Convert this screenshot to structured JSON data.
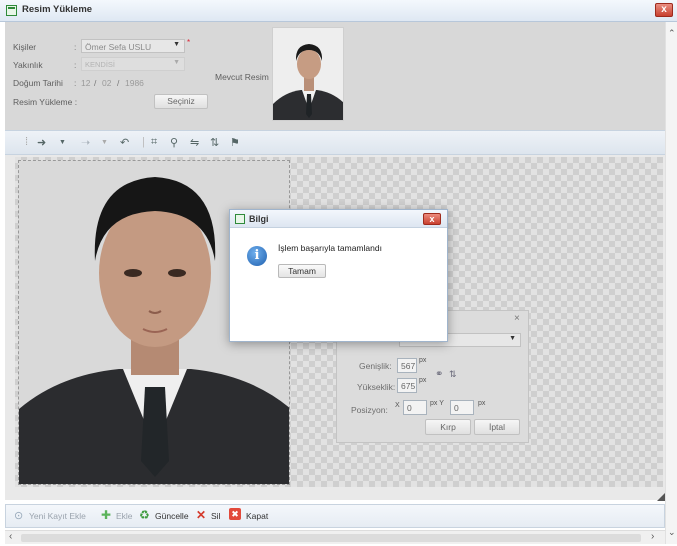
{
  "window": {
    "title": "Resim Yükleme",
    "close_glyph": "x"
  },
  "form": {
    "kisiler_label": "Kişiler",
    "kisiler_value": "Ömer Sefa USLU",
    "yakinlik_label": "Yakınlık",
    "yakinlik_value": "KENDİSİ",
    "dogum_label": "Doğum Tarihi",
    "dogum_day": "12",
    "dogum_month": "02",
    "dogum_year": "1986",
    "resim_label": "Resim Yükleme :",
    "secin_button": "Seçiniz",
    "mevcut_label": "Mevcut Resim :",
    "sep": ":",
    "date_sep": "/",
    "required_mark": "*"
  },
  "toolbar": {
    "icons": [
      "back-arrow-icon",
      "dropdown-icon",
      "forward-arrow-icon",
      "dropdown-icon",
      "rotate-icon",
      "crop-icon",
      "zoom-icon",
      "flip-horizontal-icon",
      "flip-vertical-icon",
      "flag-icon"
    ]
  },
  "crop_panel": {
    "close_glyph": "×",
    "genislik_label": "Genişlik:",
    "genislik_value": "567",
    "yukseklik_label": "Yükseklik:",
    "yukseklik_value": "675",
    "unit": "px",
    "pozisyon_label": "Posizyon:",
    "x_label": "X",
    "x_value": "0",
    "y_label": "px Y",
    "y_value": "0",
    "y_unit": "px",
    "kirp_button": "Kırp",
    "iptal_button": "İptal"
  },
  "dialog": {
    "title": "Bilgi",
    "close_glyph": "x",
    "message": "İşlem başarıyla tamamlandı",
    "ok_button": "Tamam"
  },
  "bottom_bar": {
    "yeni_kayit": "Yeni Kayıt Ekle",
    "ekle": "Ekle",
    "guncelle": "Güncelle",
    "sil": "Sil",
    "kapat": "Kapat"
  },
  "colors": {
    "accent": "#2f8a3a",
    "close": "#c8402f",
    "info": "#1f5fae"
  }
}
